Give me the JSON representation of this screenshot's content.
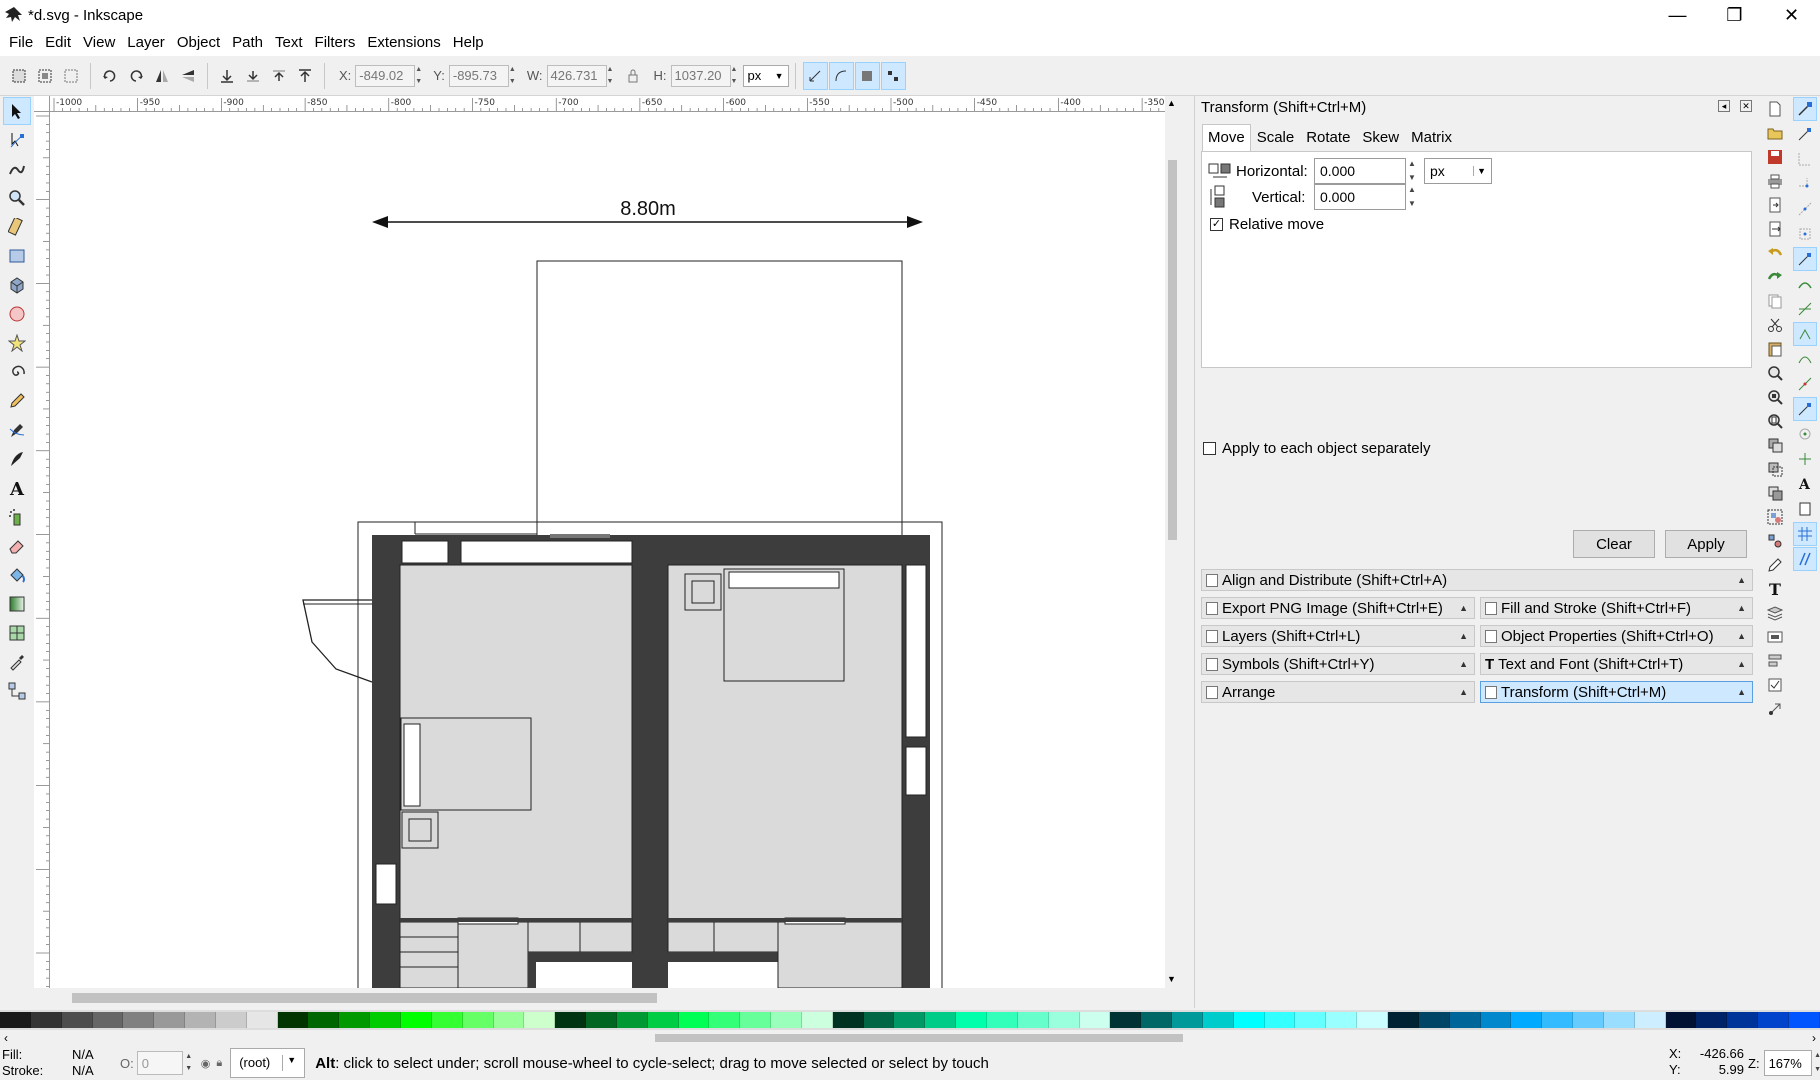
{
  "window": {
    "title": "*d.svg - Inkscape",
    "minimize": "—",
    "maximize": "❐",
    "close": "✕"
  },
  "menu": [
    "File",
    "Edit",
    "View",
    "Layer",
    "Object",
    "Path",
    "Text",
    "Filters",
    "Extensions",
    "Help"
  ],
  "tool_controls": {
    "x_label": "X:",
    "x_value": "-849.02",
    "y_label": "Y:",
    "y_value": "-895.73",
    "w_label": "W:",
    "w_value": "426.731",
    "h_label": "H:",
    "h_value": "1037.20",
    "unit": "px"
  },
  "ruler_labels": [
    "-1000",
    "-950",
    "-900",
    "-850",
    "-800",
    "-750",
    "-700",
    "-650",
    "-600",
    "-550",
    "-500",
    "-450",
    "-400",
    "-350"
  ],
  "canvas": {
    "dimension_label": "8.80m"
  },
  "dock": {
    "title": "Transform (Shift+Ctrl+M)",
    "tabs": [
      "Move",
      "Scale",
      "Rotate",
      "Skew",
      "Matrix"
    ],
    "active_tab": "Move",
    "horizontal_label": "Horizontal:",
    "horizontal_value": "0.000",
    "vertical_label": "Vertical:",
    "vertical_value": "0.000",
    "unit": "px",
    "relative_move_label": "Relative move",
    "relative_move_checked": true,
    "apply_each_label": "Apply to each object separately",
    "apply_each_checked": false,
    "clear_label": "Clear",
    "apply_label": "Apply",
    "panels": {
      "align": "Align and Distribute (Shift+Ctrl+A)",
      "export": "Export PNG Image (Shift+Ctrl+E)",
      "fill_stroke": "Fill and Stroke (Shift+Ctrl+F)",
      "layers": "Layers (Shift+Ctrl+L)",
      "obj_props": "Object Properties (Shift+Ctrl+O)",
      "symbols": "Symbols (Shift+Ctrl+Y)",
      "text_font": "Text and Font (Shift+Ctrl+T)",
      "arrange": "Arrange",
      "transform": "Transform (Shift+Ctrl+M)"
    }
  },
  "palette": [
    "#1a1a1a",
    "#333333",
    "#4d4d4d",
    "#666666",
    "#808080",
    "#999999",
    "#b3b3b3",
    "#cccccc",
    "#e6e6e6",
    "#003300",
    "#006600",
    "#009900",
    "#00cc00",
    "#00ff00",
    "#33ff33",
    "#66ff66",
    "#99ff99",
    "#ccffcc",
    "#003311",
    "#006622",
    "#009933",
    "#00cc44",
    "#00ff55",
    "#33ff77",
    "#66ff99",
    "#99ffbb",
    "#ccffdd",
    "#003322",
    "#006644",
    "#009966",
    "#00cc88",
    "#00ffaa",
    "#33ffbb",
    "#66ffcc",
    "#99ffdd",
    "#ccffee",
    "#003333",
    "#006666",
    "#009999",
    "#00cccc",
    "#00ffff",
    "#33ffff",
    "#66ffff",
    "#99ffff",
    "#ccffff",
    "#002233",
    "#004466",
    "#006699",
    "#0088cc",
    "#00aaff",
    "#33bbff",
    "#66ccff",
    "#99ddff",
    "#cceeff",
    "#001133",
    "#002266",
    "#003399",
    "#0044cc",
    "#0055ff"
  ],
  "status": {
    "fill_label": "Fill:",
    "fill_value": "N/A",
    "stroke_label": "Stroke:",
    "stroke_value": "N/A",
    "opacity_label": "O:",
    "opacity_value": "0",
    "layer": "(root)",
    "message_bold": "Alt",
    "message": ": click to select under; scroll mouse-wheel to cycle-select; drag to move selected or select by touch",
    "x_label": "X:",
    "x_value": "-426.66",
    "y_label": "Y:",
    "y_value": "5.99",
    "zoom_label": "Z:",
    "zoom_value": "167%"
  }
}
